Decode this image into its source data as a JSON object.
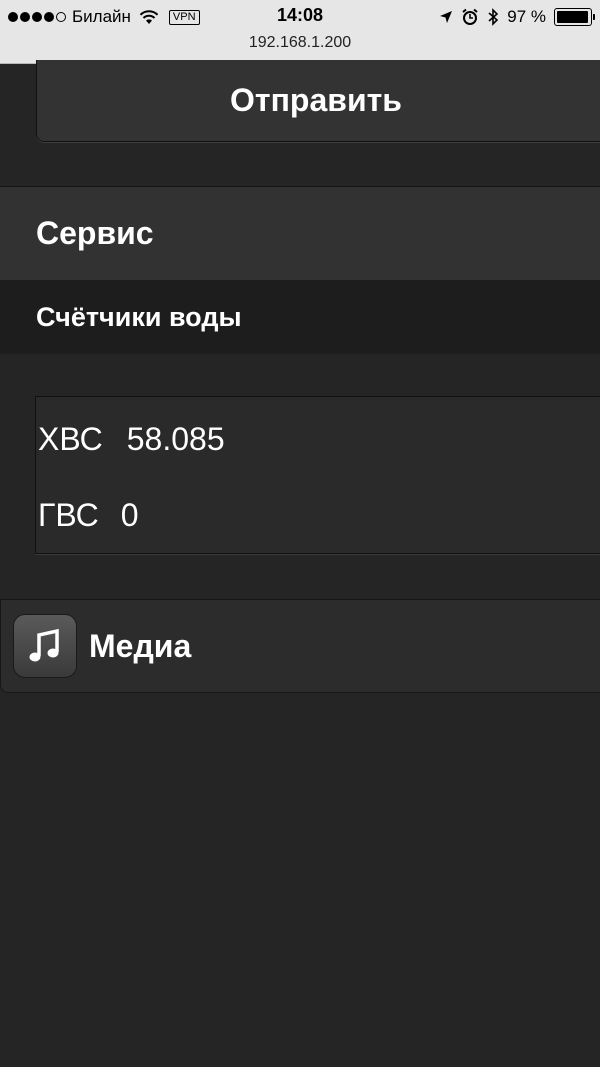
{
  "status_bar": {
    "carrier": "Билайн",
    "vpn": "VPN",
    "time": "14:08",
    "url": "192.168.1.200",
    "battery_text": "97 %",
    "battery_level": 0.97
  },
  "send_button": {
    "label": "Отправить"
  },
  "service": {
    "title": "Сервис"
  },
  "water_meters": {
    "title": "Счётчики воды",
    "cold": {
      "label": "ХВС",
      "value": "58.085"
    },
    "hot": {
      "label": "ГВС",
      "value": "0"
    }
  },
  "media": {
    "label": "Медиа",
    "icon": "music-note-icon"
  }
}
